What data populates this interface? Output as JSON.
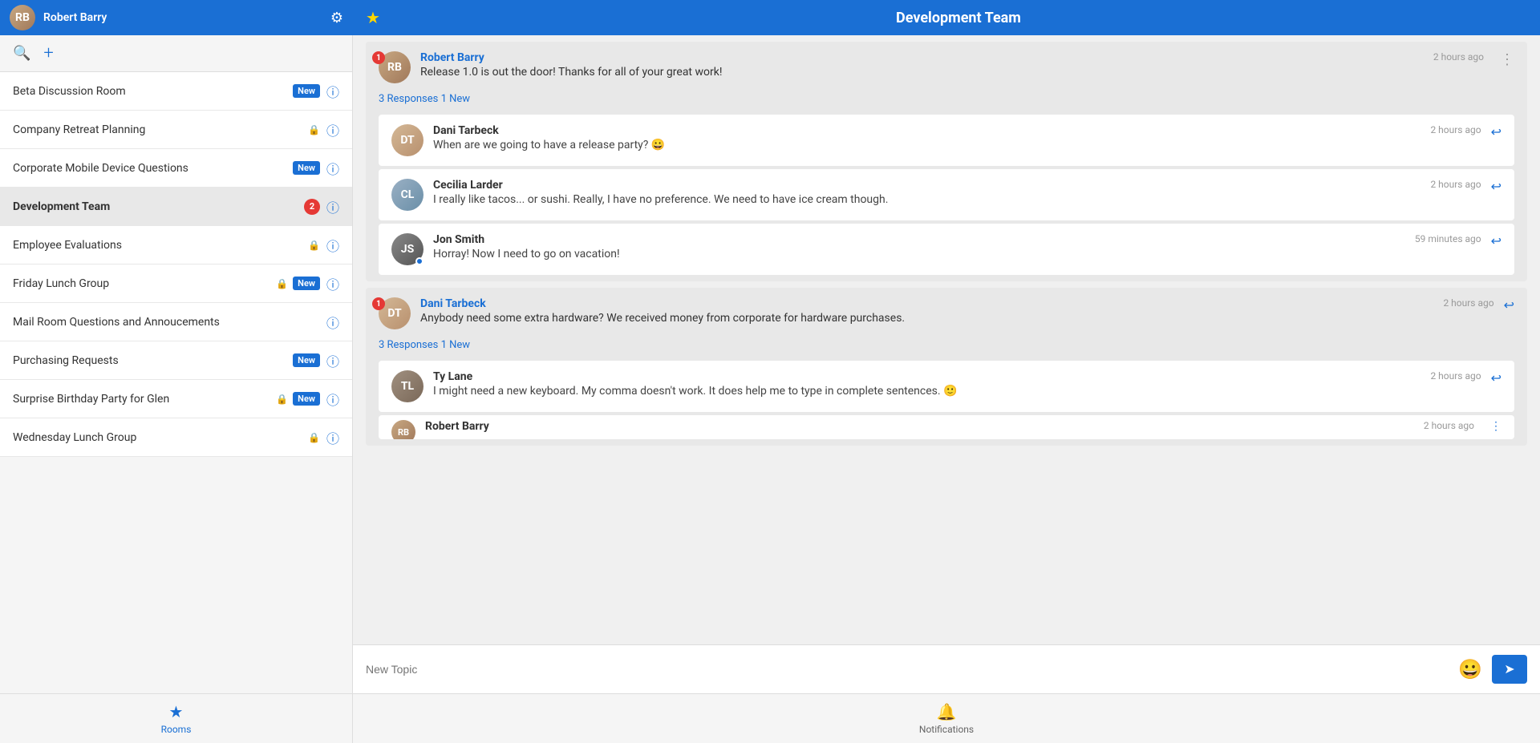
{
  "header": {
    "user_name": "Robert Barry",
    "channel_title": "Development Team",
    "settings_icon": "⚙",
    "star_icon": "★"
  },
  "sidebar": {
    "search_placeholder": "Search",
    "rooms": [
      {
        "id": "beta",
        "label": "Beta Discussion Room",
        "badge": "New",
        "has_lock": false
      },
      {
        "id": "company-retreat",
        "label": "Company Retreat Planning",
        "badge": null,
        "has_lock": true
      },
      {
        "id": "corporate-mobile",
        "label": "Corporate Mobile Device Questions",
        "badge": "New",
        "has_lock": false
      },
      {
        "id": "development-team",
        "label": "Development Team",
        "badge": null,
        "has_lock": false,
        "unread": "2",
        "active": true
      },
      {
        "id": "employee-eval",
        "label": "Employee Evaluations",
        "badge": null,
        "has_lock": true
      },
      {
        "id": "friday-lunch",
        "label": "Friday Lunch Group",
        "badge": "New",
        "has_lock": true
      },
      {
        "id": "mail-room",
        "label": "Mail Room Questions and Annoucements",
        "badge": null,
        "has_lock": false
      },
      {
        "id": "purchasing",
        "label": "Purchasing Requests",
        "badge": "New",
        "has_lock": false
      },
      {
        "id": "surprise-bday",
        "label": "Surprise Birthday Party for Glen",
        "badge": "New",
        "has_lock": true
      },
      {
        "id": "wednesday-lunch",
        "label": "Wednesday Lunch Group",
        "badge": null,
        "has_lock": true
      }
    ],
    "nav": {
      "rooms_label": "Rooms",
      "notifications_label": "Notifications"
    }
  },
  "chat": {
    "threads": [
      {
        "id": "thread1",
        "badge": "1",
        "author": "Robert Barry",
        "text": "Release 1.0 is out the door! Thanks for all of your great work!",
        "timestamp": "2 hours ago",
        "responses_text": "3 Responses 1 New",
        "replies": [
          {
            "id": "reply1",
            "author": "Dani Tarbeck",
            "text": "When are we going to have a release party? 😀",
            "timestamp": "2 hours ago",
            "online": false,
            "avatar_type": "dani"
          },
          {
            "id": "reply2",
            "author": "Cecilia Larder",
            "text": "I really like tacos... or sushi. Really, I have no preference. We need to have ice cream though.",
            "timestamp": "2 hours ago",
            "online": false,
            "avatar_type": "cecilia"
          },
          {
            "id": "reply3",
            "author": "Jon Smith",
            "text": "Horray! Now I need to go on vacation!",
            "timestamp": "59 minutes ago",
            "online": true,
            "avatar_type": "jon"
          }
        ]
      },
      {
        "id": "thread2",
        "badge": "1",
        "author": "Dani Tarbeck",
        "text": "Anybody need some extra hardware? We received money from corporate for hardware purchases.",
        "timestamp": "2 hours ago",
        "responses_text": "3 Responses 1 New",
        "replies": [
          {
            "id": "reply4",
            "author": "Ty Lane",
            "text": "I might need a new keyboard. My comma doesn't work. It does help me to type in complete sentences. 🙂",
            "timestamp": "2 hours ago",
            "online": false,
            "avatar_type": "ty"
          },
          {
            "id": "reply5",
            "author": "Robert Barry",
            "text": "",
            "timestamp": "2 hours ago",
            "online": false,
            "avatar_type": "rb",
            "partial": true
          }
        ]
      }
    ],
    "input_placeholder": "New Topic",
    "send_icon": "➤",
    "emoji_icon": "😀"
  }
}
